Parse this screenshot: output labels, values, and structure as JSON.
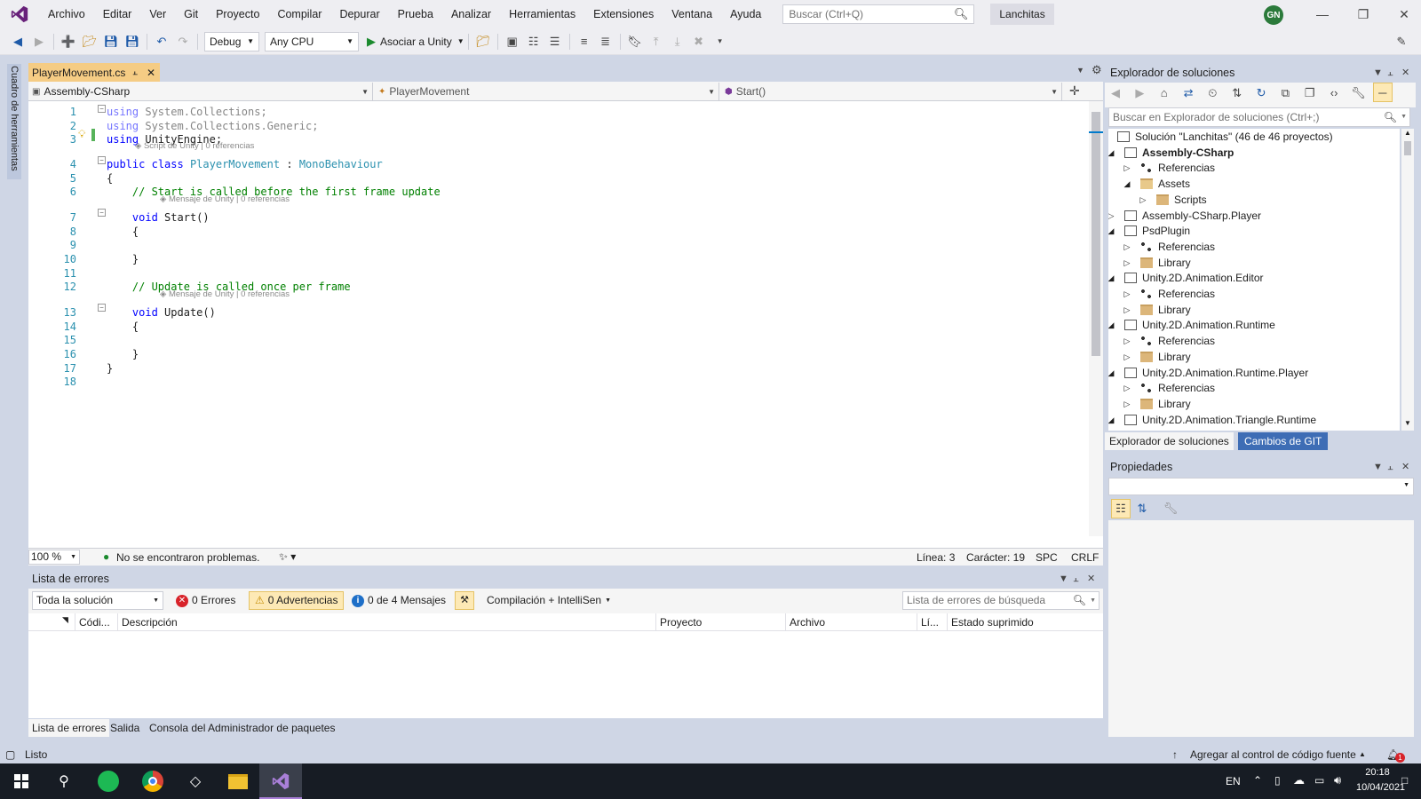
{
  "menubar": {
    "items": [
      "Archivo",
      "Editar",
      "Ver",
      "Git",
      "Proyecto",
      "Compilar",
      "Depurar",
      "Prueba",
      "Analizar",
      "Herramientas",
      "Extensiones",
      "Ventana",
      "Ayuda"
    ],
    "search_placeholder": "Buscar (Ctrl+Q)",
    "solution_name": "Lanchitas",
    "user_initials": "GN"
  },
  "toolbar": {
    "config": "Debug",
    "platform": "Any CPU",
    "run_label": "Asociar a Unity"
  },
  "toolstrip": {
    "label": "Cuadro de herramientas"
  },
  "editor": {
    "tab_label": "PlayerMovement.cs",
    "nav_project": "Assembly-CSharp",
    "nav_class": "PlayerMovement",
    "nav_member": "Start()",
    "zoom": "100 %",
    "status_ok": "No se encontraron problemas.",
    "line": "Línea: 3",
    "char": "Carácter: 19",
    "spc": "SPC",
    "eol": "CRLF",
    "lines": [
      {
        "n": "1",
        "code": "using System.Collections;"
      },
      {
        "n": "2",
        "code": "using System.Collections.Generic;"
      },
      {
        "n": "3",
        "code": "using UnityEngine;"
      },
      {
        "n": "4",
        "code": "public class PlayerMovement : MonoBehaviour"
      },
      {
        "n": "5",
        "code": "{"
      },
      {
        "n": "6",
        "code": "    // Start is called before the first frame update"
      },
      {
        "n": "7",
        "code": "    void Start()"
      },
      {
        "n": "8",
        "code": "    {"
      },
      {
        "n": "9",
        "code": ""
      },
      {
        "n": "10",
        "code": "    }"
      },
      {
        "n": "11",
        "code": ""
      },
      {
        "n": "12",
        "code": "    // Update is called once per frame"
      },
      {
        "n": "13",
        "code": "    void Update()"
      },
      {
        "n": "14",
        "code": "    {"
      },
      {
        "n": "15",
        "code": ""
      },
      {
        "n": "16",
        "code": "    }"
      },
      {
        "n": "17",
        "code": "}"
      },
      {
        "n": "18",
        "code": ""
      }
    ],
    "hint_script": "Script de Unity | 0 referencias",
    "hint_message1": "Mensaje de Unity | 0 referencias",
    "hint_message2": "Mensaje de Unity | 0 referencias"
  },
  "errorlist": {
    "title": "Lista de errores",
    "scope": "Toda la solución",
    "errors": "0 Errores",
    "warnings": "0 Advertencias",
    "messages": "0 de 4 Mensajes",
    "build": "Compilación + IntelliSen",
    "search_placeholder": "Lista de errores de búsqueda",
    "columns": [
      "Códi...",
      "Descripción",
      "Proyecto",
      "Archivo",
      "Lí...",
      "Estado suprimido"
    ]
  },
  "bottom_tabs": [
    "Lista de errores",
    "Salida",
    "Consola del Administrador de paquetes"
  ],
  "solution_explorer": {
    "title": "Explorador de soluciones",
    "search_placeholder": "Buscar en Explorador de soluciones (Ctrl+;)",
    "tree": [
      {
        "label": "Solución \"Lanchitas\" (46 de 46 proyectos)",
        "level": 0,
        "exp": "",
        "icon": "solution",
        "bold": false
      },
      {
        "label": "Assembly-CSharp",
        "level": 0,
        "exp": "open",
        "icon": "project",
        "bold": true
      },
      {
        "label": "Referencias",
        "level": 1,
        "exp": "closed",
        "icon": "references",
        "bold": false
      },
      {
        "label": "Assets",
        "level": 1,
        "exp": "open",
        "icon": "folder-open",
        "bold": false
      },
      {
        "label": "Scripts",
        "level": 2,
        "exp": "closed",
        "icon": "folder",
        "bold": false
      },
      {
        "label": "Assembly-CSharp.Player",
        "level": 0,
        "exp": "closed",
        "icon": "project",
        "bold": false
      },
      {
        "label": "PsdPlugin",
        "level": 0,
        "exp": "open",
        "icon": "project",
        "bold": false
      },
      {
        "label": "Referencias",
        "level": 1,
        "exp": "closed",
        "icon": "references",
        "bold": false
      },
      {
        "label": "Library",
        "level": 1,
        "exp": "closed",
        "icon": "folder",
        "bold": false
      },
      {
        "label": "Unity.2D.Animation.Editor",
        "level": 0,
        "exp": "open",
        "icon": "project",
        "bold": false
      },
      {
        "label": "Referencias",
        "level": 1,
        "exp": "closed",
        "icon": "references",
        "bold": false
      },
      {
        "label": "Library",
        "level": 1,
        "exp": "closed",
        "icon": "folder",
        "bold": false
      },
      {
        "label": "Unity.2D.Animation.Runtime",
        "level": 0,
        "exp": "open",
        "icon": "project",
        "bold": false
      },
      {
        "label": "Referencias",
        "level": 1,
        "exp": "closed",
        "icon": "references",
        "bold": false
      },
      {
        "label": "Library",
        "level": 1,
        "exp": "closed",
        "icon": "folder",
        "bold": false
      },
      {
        "label": "Unity.2D.Animation.Runtime.Player",
        "level": 0,
        "exp": "open",
        "icon": "project",
        "bold": false
      },
      {
        "label": "Referencias",
        "level": 1,
        "exp": "closed",
        "icon": "references",
        "bold": false
      },
      {
        "label": "Library",
        "level": 1,
        "exp": "closed",
        "icon": "folder",
        "bold": false
      },
      {
        "label": "Unity.2D.Animation.Triangle.Runtime",
        "level": 0,
        "exp": "open",
        "icon": "project",
        "bold": false
      }
    ],
    "tabs": [
      "Explorador de soluciones",
      "Cambios de GIT"
    ]
  },
  "properties": {
    "title": "Propiedades"
  },
  "statusbar": {
    "ready": "Listo",
    "source_control": "Agregar al control de código fuente",
    "notifications": "1"
  },
  "taskbar": {
    "lang": "EN",
    "time": "20:18",
    "date": "10/04/2021"
  },
  "colors": {
    "accent": "#007acc",
    "tab_active": "#f5cc84",
    "vs_purple": "#68217a"
  }
}
